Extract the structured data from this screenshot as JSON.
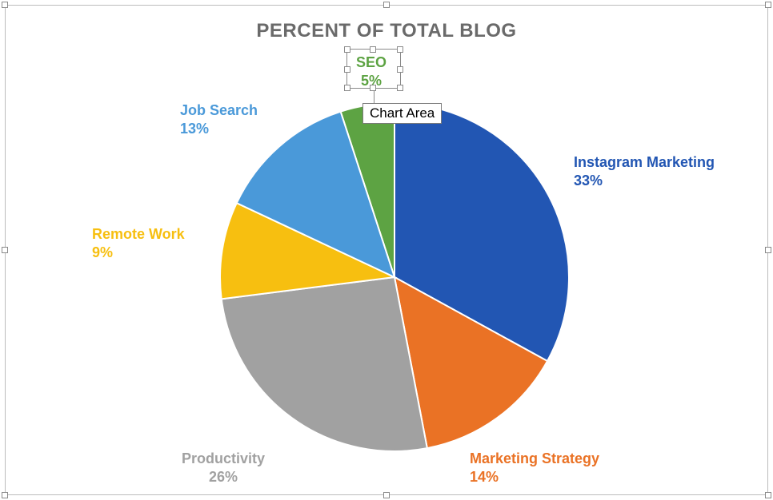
{
  "title": "PERCENT OF TOTAL BLOG",
  "tooltip": "Chart Area",
  "labels": {
    "seo": {
      "name": "SEO",
      "pct": "5%"
    },
    "instagram": {
      "name": "Instagram Marketing",
      "pct": "33%"
    },
    "strategy": {
      "name": "Marketing Strategy",
      "pct": "14%"
    },
    "productivity": {
      "name": "Productivity",
      "pct": "26%"
    },
    "remote": {
      "name": "Remote Work",
      "pct": "9%"
    },
    "jobsearch": {
      "name": "Job Search",
      "pct": "13%"
    }
  },
  "colors": {
    "seo": "#5da343",
    "instagram": "#2256b3",
    "strategy": "#ea7225",
    "productivity": "#a1a1a1",
    "remote": "#f7bf10",
    "jobsearch": "#4a99d9",
    "title": "#6a6a6a"
  },
  "chart_data": {
    "type": "pie",
    "title": "PERCENT OF TOTAL BLOG",
    "series": [
      {
        "name": "SEO",
        "value": 5,
        "color": "#5da343"
      },
      {
        "name": "Instagram Marketing",
        "value": 33,
        "color": "#2256b3"
      },
      {
        "name": "Marketing Strategy",
        "value": 14,
        "color": "#ea7225"
      },
      {
        "name": "Productivity",
        "value": 26,
        "color": "#a1a1a1"
      },
      {
        "name": "Remote Work",
        "value": 9,
        "color": "#f7bf10"
      },
      {
        "name": "Job Search",
        "value": 13,
        "color": "#4a99d9"
      }
    ],
    "start_angle_deg_from_top": -18,
    "direction": "clockwise"
  }
}
